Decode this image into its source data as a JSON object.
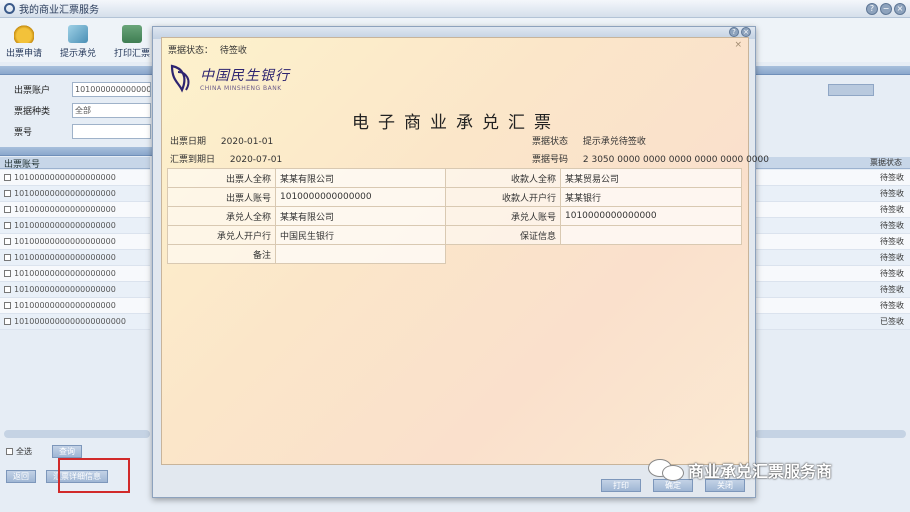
{
  "app": {
    "title": "我的商业汇票服务",
    "window_controls": [
      "?",
      "−",
      "×"
    ]
  },
  "toolbar": {
    "items": [
      {
        "label": "出票申请"
      },
      {
        "label": "提示承兑"
      },
      {
        "label": "打印汇票"
      }
    ]
  },
  "query": {
    "fields": [
      {
        "label": "出票账户",
        "value": "101000000000000..."
      },
      {
        "label": "票据种类",
        "value": "全部"
      },
      {
        "label": "票号",
        "value": ""
      }
    ]
  },
  "grid": {
    "header": "出票账号",
    "rows": [
      "10100000000000000000",
      "10100000000000000000",
      "10100000000000000000",
      "10100000000000000000",
      "10100000000000000000",
      "10100000000000000000",
      "10100000000000000000",
      "10100000000000000000",
      "10100000000000000000",
      "1010000000000000000000"
    ],
    "right_header": "票据状态",
    "right_rows": [
      "待签收",
      "待签收",
      "待签收",
      "待签收",
      "待签收",
      "待签收",
      "待签收",
      "待签收",
      "待签收",
      "已签收"
    ]
  },
  "bottom": {
    "checkbox_label": "全选",
    "btn_query": "查询",
    "btn_back": "返回",
    "btn_detail": "汇票详细信息"
  },
  "bill": {
    "status_label": "票据状态：",
    "status_value": "待签收",
    "bank_name_cn": "中国民生银行",
    "bank_name_en": "CHINA MINSHENG BANK",
    "title": "电子商业承兑汇票",
    "issue_date_label": "出票日期",
    "issue_date_value": "2020-01-01",
    "due_date_label": "汇票到期日",
    "due_date_value": "2020-07-01",
    "acceptance_label": "票据状态",
    "acceptance_value": "提示承兑待签收",
    "bill_no_label": "票据号码",
    "bill_no_value": "2 3050 0000 0000 0000 0000 0000 0000",
    "table": [
      {
        "l1": "出票人全称",
        "v1": "某某有限公司",
        "l2": "收款人全称",
        "v2": "某某贸易公司"
      },
      {
        "l1": "出票人账号",
        "v1": "1010000000000000",
        "l2": "收款人开户行",
        "v2": "某某银行"
      },
      {
        "l1": "承兑人全称",
        "v1": "某某有限公司",
        "l2": "承兑人账号",
        "v2": "1010000000000000"
      },
      {
        "l1": "承兑人开户行",
        "v1": "中国民生银行",
        "l2": "保证信息",
        "v2": ""
      },
      {
        "l1": "备注",
        "v1": "",
        "l2": "",
        "v2": ""
      }
    ],
    "close": "×"
  },
  "modal_buttons": [
    "打印",
    "确定",
    "关闭"
  ],
  "watermark": "商业承兑汇票服务商",
  "colors": {
    "highlight": "#d12a2a",
    "paper": "#fbe6c9",
    "accent_blue": "#8ba7cc"
  }
}
